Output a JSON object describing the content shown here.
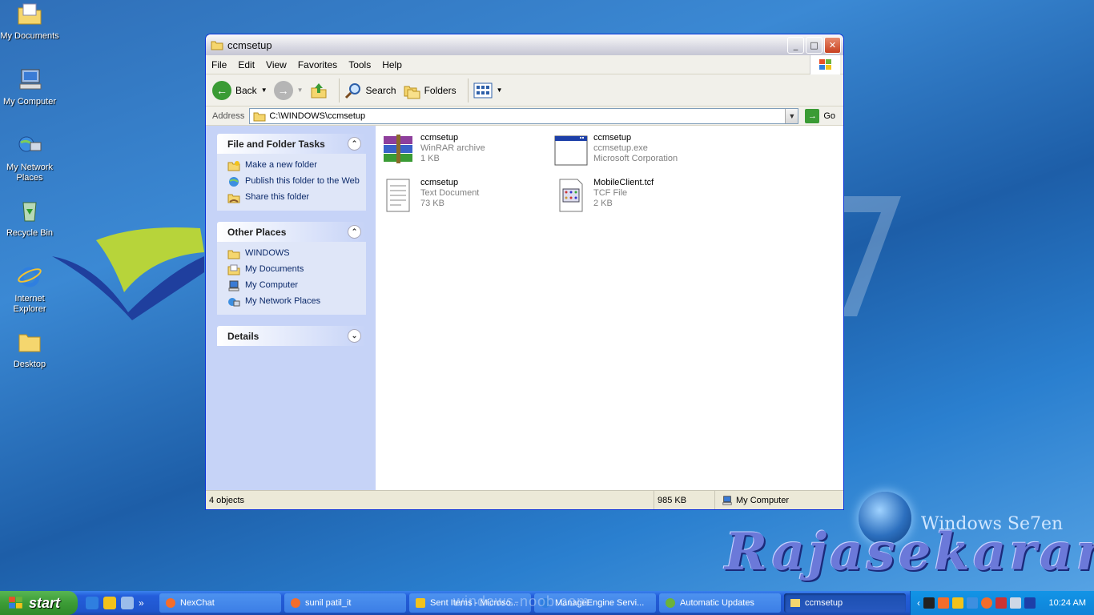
{
  "desktop": {
    "icons": [
      {
        "label": "My Documents"
      },
      {
        "label": "My Computer"
      },
      {
        "label": "My Network Places"
      },
      {
        "label": "Recycle Bin"
      },
      {
        "label": "Internet Explorer"
      },
      {
        "label": "Desktop"
      }
    ],
    "brand_text": "Windows Se7en",
    "author_text": "Rajasekaran",
    "watermark": "windows-noob.com"
  },
  "window": {
    "title": "ccmsetup",
    "menu": [
      "File",
      "Edit",
      "View",
      "Favorites",
      "Tools",
      "Help"
    ],
    "toolbar": {
      "back": "Back",
      "search": "Search",
      "folders": "Folders"
    },
    "address": {
      "label": "Address",
      "value": "C:\\WINDOWS\\ccmsetup",
      "go": "Go"
    },
    "tasks": {
      "file_folder": {
        "title": "File and Folder Tasks",
        "items": [
          "Make a new folder",
          "Publish this folder to the Web",
          "Share this folder"
        ]
      },
      "other_places": {
        "title": "Other Places",
        "items": [
          "WINDOWS",
          "My Documents",
          "My Computer",
          "My Network Places"
        ]
      },
      "details": {
        "title": "Details"
      }
    },
    "files": [
      {
        "name": "ccmsetup",
        "type": "WinRAR archive",
        "size": "1 KB",
        "icon": "winrar-icon"
      },
      {
        "name": "ccmsetup",
        "type": "ccmsetup.exe",
        "size": "Microsoft Corporation",
        "icon": "exe-icon"
      },
      {
        "name": "ccmsetup",
        "type": "Text Document",
        "size": "73 KB",
        "icon": "text-doc-icon"
      },
      {
        "name": "MobileClient.tcf",
        "type": "TCF File",
        "size": "2 KB",
        "icon": "tcf-icon"
      }
    ],
    "status": {
      "objects": "4 objects",
      "size": "985 KB",
      "location": "My Computer"
    }
  },
  "taskbar": {
    "start": "start",
    "tasks": [
      {
        "label": "NexChat",
        "active": false
      },
      {
        "label": "sunil patil_it",
        "active": false
      },
      {
        "label": "Sent Items - Microso...",
        "active": false
      },
      {
        "label": "ManageEngine Servi...",
        "active": false
      },
      {
        "label": "Automatic Updates",
        "active": false
      },
      {
        "label": "ccmsetup",
        "active": true
      }
    ],
    "clock": "10:24 AM"
  },
  "colors": {
    "xp_blue": "#0831d9",
    "start_green": "#3c9c36",
    "taskbar_blue": "#245edb"
  }
}
